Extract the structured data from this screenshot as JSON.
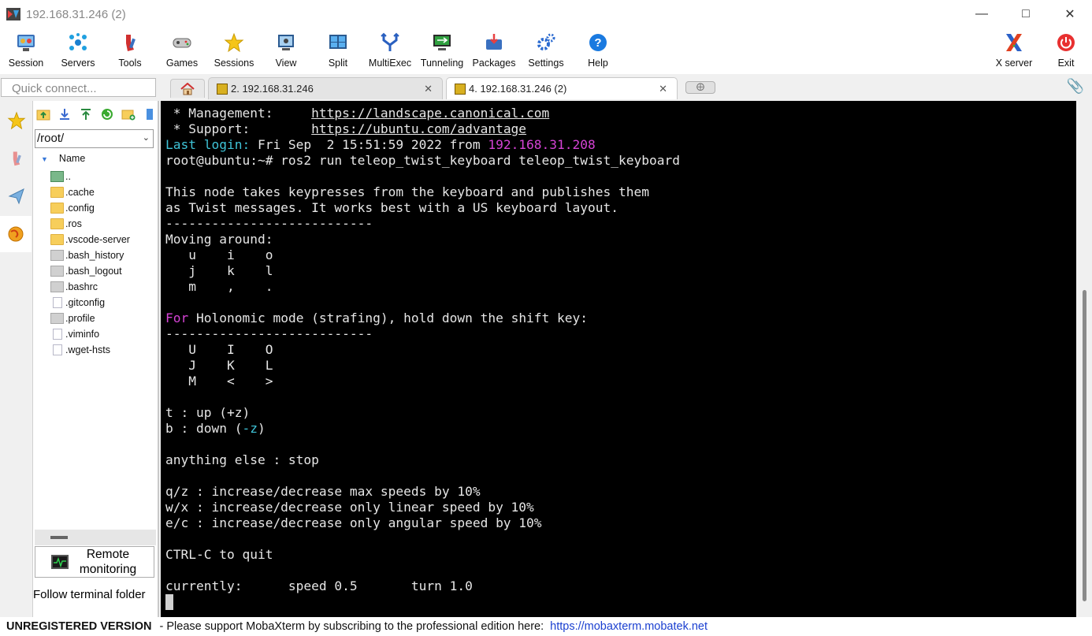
{
  "window": {
    "title": "192.168.31.246 (2)"
  },
  "toolbar": {
    "items": [
      {
        "label": "Session",
        "icon": "session-icon"
      },
      {
        "label": "Servers",
        "icon": "servers-icon"
      },
      {
        "label": "Tools",
        "icon": "tools-icon"
      },
      {
        "label": "Games",
        "icon": "games-icon"
      },
      {
        "label": "Sessions",
        "icon": "star-icon"
      },
      {
        "label": "View",
        "icon": "view-icon"
      },
      {
        "label": "Split",
        "icon": "split-icon"
      },
      {
        "label": "MultiExec",
        "icon": "multiexec-icon"
      },
      {
        "label": "Tunneling",
        "icon": "tunneling-icon"
      },
      {
        "label": "Packages",
        "icon": "packages-icon"
      },
      {
        "label": "Settings",
        "icon": "settings-icon"
      },
      {
        "label": "Help",
        "icon": "help-icon"
      }
    ],
    "xserver_label": "X server",
    "exit_label": "Exit"
  },
  "quick_connect": {
    "placeholder": "Quick connect..."
  },
  "tabs": [
    {
      "label": "2. 192.168.31.246",
      "active": false
    },
    {
      "label": "4. 192.168.31.246 (2)",
      "active": true
    }
  ],
  "file_browser": {
    "path": "/root/",
    "column_header": "Name",
    "items": [
      {
        "name": "..",
        "type": "up"
      },
      {
        "name": ".cache",
        "type": "folder"
      },
      {
        "name": ".config",
        "type": "folder"
      },
      {
        "name": ".ros",
        "type": "folder"
      },
      {
        "name": ".vscode-server",
        "type": "folder"
      },
      {
        "name": ".bash_history",
        "type": "file"
      },
      {
        "name": ".bash_logout",
        "type": "file"
      },
      {
        "name": ".bashrc",
        "type": "file"
      },
      {
        "name": ".gitconfig",
        "type": "doc"
      },
      {
        "name": ".profile",
        "type": "file"
      },
      {
        "name": ".viminfo",
        "type": "doc"
      },
      {
        "name": ".wget-hsts",
        "type": "doc"
      }
    ],
    "remote_monitoring_label": "Remote monitoring",
    "follow_label": "Follow terminal folder"
  },
  "terminal": {
    "management_label": " * Management:     ",
    "management_url": "https://landscape.canonical.com",
    "support_label": " * Support:        ",
    "support_url": "https://ubuntu.com/advantage",
    "last_login_label": "Last login:",
    "last_login_text": " Fri Sep  2 15:51:59 2022 from ",
    "last_login_ip": "192.168.31.208",
    "prompt_line": "root@ubuntu:~# ros2 run teleop_twist_keyboard teleop_twist_keyboard",
    "intro1": "This node takes keypresses from the keyboard and publishes them",
    "intro2": "as Twist messages. It works best with a US keyboard layout.",
    "rule1": "---------------------------",
    "moving": "Moving around:",
    "row_u": "   u    i    o",
    "row_j": "   j    k    l",
    "row_m": "   m    ,    .",
    "for_kw": "For",
    "holonomic": " Holonomic mode (strafing), hold down the shift key:",
    "rule2": "---------------------------",
    "row_U": "   U    I    O",
    "row_J": "   J    K    L",
    "row_M": "   M    <    >",
    "t_line": "t : up (+z)",
    "b_pre": "b : down (",
    "b_mid": "-z",
    "b_post": ")",
    "else_line": "anything else : stop",
    "qz_line": "q/z : increase/decrease max speeds by 10%",
    "wx_line": "w/x : increase/decrease only linear speed by 10%",
    "ec_line": "e/c : increase/decrease only angular speed by 10%",
    "quit_line": "CTRL-C to quit",
    "current_line": "currently:      speed 0.5       turn 1.0"
  },
  "status_bar": {
    "unregistered": "UNREGISTERED VERSION",
    "message": " -  Please support MobaXterm by subscribing to the professional edition here:",
    "url": "https://mobaxterm.mobatek.net"
  },
  "colors": {
    "terminal_bg": "#000000",
    "terminal_fg": "#e6e6e6",
    "cyan": "#3fc3d7",
    "magenta": "#d543d5",
    "link_blue": "#1a3fd0"
  }
}
